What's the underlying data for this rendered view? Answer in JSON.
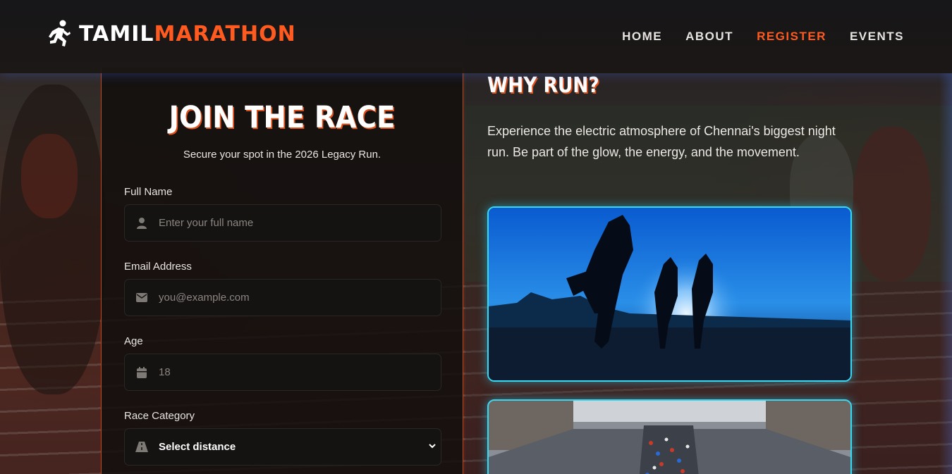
{
  "brand": {
    "part1": "TAMIL",
    "part2": "MARATHON",
    "accent": "#ff5a1f",
    "icon": "runner-icon"
  },
  "nav": {
    "items": [
      {
        "label": "HOME",
        "active": false
      },
      {
        "label": "ABOUT",
        "active": false
      },
      {
        "label": "REGISTER",
        "active": true
      },
      {
        "label": "EVENTS",
        "active": false
      }
    ]
  },
  "form": {
    "title": "JOIN THE RACE",
    "subtitle": "Secure your spot in the 2026 Legacy Run.",
    "fields": [
      {
        "label": "Full Name",
        "placeholder": "Enter your full name",
        "icon": "user-icon"
      },
      {
        "label": "Email Address",
        "placeholder": "you@example.com",
        "icon": "envelope-icon"
      },
      {
        "label": "Age",
        "placeholder": "18",
        "icon": "calendar-icon"
      },
      {
        "label": "Race Category",
        "selected": "Select distance",
        "icon": "road-icon"
      }
    ]
  },
  "why": {
    "title": "WHY RUN?",
    "text": "Experience the electric atmosphere of Chennai's biggest night run. Be part of the glow, the energy, and the movement."
  },
  "colors": {
    "accent": "#ff5a1f",
    "card_border": "#c8461a",
    "photo_border": "#3ad8f0"
  }
}
